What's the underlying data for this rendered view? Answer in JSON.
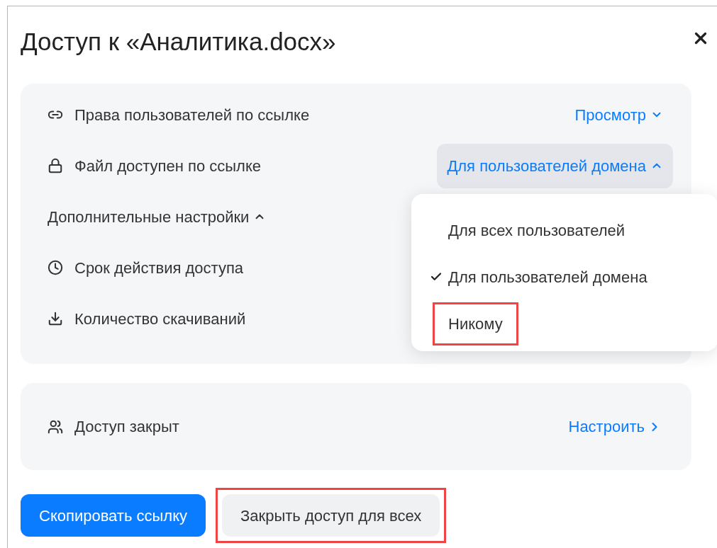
{
  "dialog": {
    "title": "Доступ к «Аналитика.docx»"
  },
  "settings": [
    {
      "kind": "select",
      "label": "Права пользователей по ссылке",
      "value": "Просмотр",
      "expanded": false
    },
    {
      "kind": "select",
      "label": "Файл доступен по ссылке",
      "value": "Для пользователей домена",
      "expanded": true
    },
    {
      "kind": "toggle",
      "label": "Дополнительные настройки",
      "expanded": true
    },
    {
      "kind": "item",
      "label": "Срок действия доступа"
    },
    {
      "kind": "item",
      "label": "Количество скачиваний"
    }
  ],
  "menu": {
    "options": [
      {
        "label": "Для всех пользователей",
        "selected": false,
        "highlighted": false
      },
      {
        "label": "Для пользователей домена",
        "selected": true,
        "highlighted": false
      },
      {
        "label": "Никому",
        "selected": false,
        "highlighted": true
      }
    ]
  },
  "access": {
    "label": "Доступ закрыт",
    "action": "Настроить"
  },
  "buttons": [
    {
      "label": "Скопировать ссылку",
      "kind": "primary",
      "highlighted": false
    },
    {
      "label": "Закрыть доступ для всех",
      "kind": "secondary",
      "highlighted": true
    }
  ]
}
